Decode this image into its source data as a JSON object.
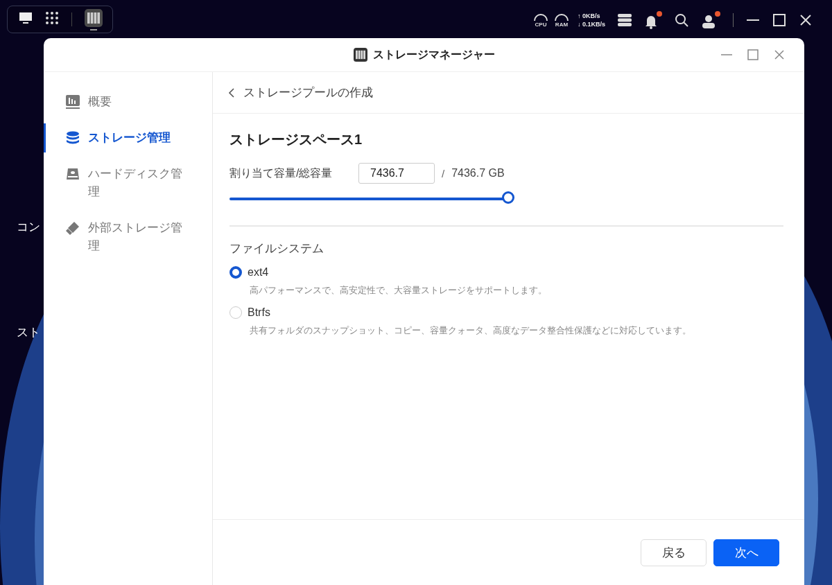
{
  "desktop": {
    "icon_labels": [
      "コン",
      "スト"
    ]
  },
  "taskbar": {
    "apps": [
      {
        "kind": "monitor",
        "selected": false
      },
      {
        "kind": "grid",
        "selected": false
      },
      {
        "kind": "storage",
        "selected": true
      }
    ]
  },
  "status": {
    "cpu": "CPU",
    "ram": "RAM",
    "upload": "↑ 0KB/s",
    "download": "↓ 0.1KB/s",
    "notification_badge": true,
    "user_badge": true
  },
  "window": {
    "title": "ストレージマネージャー"
  },
  "sidebar": {
    "items": [
      {
        "label": "概要",
        "kind": "chart",
        "selected": false
      },
      {
        "label": "ストレージ管理",
        "kind": "database",
        "selected": true
      },
      {
        "label": "ハードディスク管理",
        "kind": "disk",
        "selected": false
      },
      {
        "label": "外部ストレージ管理",
        "kind": "usb",
        "selected": false
      }
    ]
  },
  "header": {
    "title": "ストレージプールの作成"
  },
  "space": {
    "title": "ストレージスペース1",
    "label": "割り当て容量/総容量",
    "value": "7436.7",
    "separator": "/",
    "total": "7436.7 GB",
    "level": 1
  },
  "filesystem": {
    "label": "ファイルシステム",
    "options": [
      {
        "label": "ext4",
        "description": "高パフォーマンスで、高安定性で、大容量ストレージをサポートします。",
        "selected": true
      },
      {
        "label": "Btrfs",
        "description": "共有フォルダのスナップショット、コピー、容量クォータ、高度なデータ整合性保護などに対応しています。",
        "selected": false
      }
    ]
  },
  "buttons": [
    {
      "label": "戻る",
      "kind": "secondary"
    },
    {
      "label": "次へ",
      "kind": "primary"
    }
  ]
}
